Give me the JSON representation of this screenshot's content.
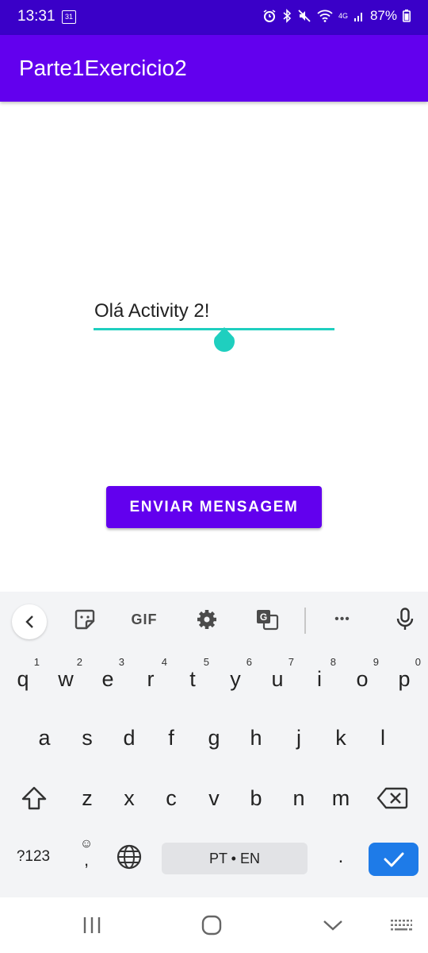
{
  "status_bar": {
    "time": "13:31",
    "calendar_day": "31",
    "network": "4G",
    "battery": "87%",
    "icons": [
      "alarm-icon",
      "bluetooth-icon",
      "mute-icon",
      "wifi-icon",
      "signal-icon",
      "battery-icon"
    ]
  },
  "app_bar": {
    "title": "Parte1Exercicio2",
    "color": "#6200ee"
  },
  "main": {
    "edit_text_value": "Olá Activity 2!",
    "accent_color": "#1fcfbf",
    "send_button_label": "ENVIAR MENSAGEM"
  },
  "keyboard": {
    "toolbar": {
      "gif_label": "GIF",
      "more_label": "•••",
      "items": [
        "back-icon",
        "sticker-icon",
        "gif-button",
        "settings-icon",
        "translate-icon",
        "more-icon",
        "mic-icon"
      ]
    },
    "row1": [
      {
        "k": "q",
        "n": "1"
      },
      {
        "k": "w",
        "n": "2"
      },
      {
        "k": "e",
        "n": "3"
      },
      {
        "k": "r",
        "n": "4"
      },
      {
        "k": "t",
        "n": "5"
      },
      {
        "k": "y",
        "n": "6"
      },
      {
        "k": "u",
        "n": "7"
      },
      {
        "k": "i",
        "n": "8"
      },
      {
        "k": "o",
        "n": "9"
      },
      {
        "k": "p",
        "n": "0"
      }
    ],
    "row2": [
      "a",
      "s",
      "d",
      "f",
      "g",
      "h",
      "j",
      "k",
      "l"
    ],
    "row3": [
      "z",
      "x",
      "c",
      "v",
      "b",
      "n",
      "m"
    ],
    "symbols_label": "?123",
    "comma_label": ",",
    "space_label": "PT • EN",
    "period_label": ".",
    "enter_color": "#1e7be8"
  },
  "nav_bar": {
    "items": [
      "recents-icon",
      "home-icon",
      "back-chevron-icon",
      "keyboard-switch-icon"
    ]
  }
}
